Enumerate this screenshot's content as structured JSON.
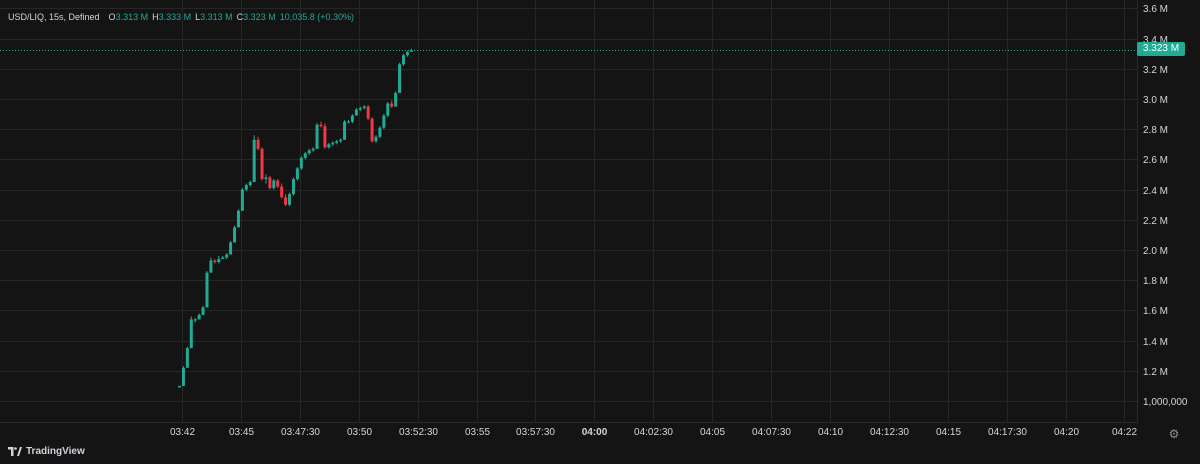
{
  "legend": {
    "symbol": "USD/LIQ, 15s, Defined",
    "open_label": "O",
    "open_value": "3.313 M",
    "high_label": "H",
    "high_value": "3.333 M",
    "low_label": "L",
    "low_value": "3.313 M",
    "close_label": "C",
    "close_value": "3.323 M",
    "change": "10,035.8 (+0.30%)"
  },
  "last_price_label": "3.323 M",
  "brand": {
    "name": "TradingView",
    "icon": "tradingview-logo-icon"
  },
  "colors": {
    "up": "#22ab94",
    "down": "#f23645",
    "grid": "#262626",
    "text": "#d1d4dc",
    "background": "#141414"
  },
  "chart_data": {
    "type": "candlestick",
    "title": "USD/LIQ, 15s, Defined",
    "interval_seconds": 15,
    "x_ticks": [
      "03:42",
      "03:45",
      "03:47:30",
      "03:50",
      "03:52:30",
      "03:55",
      "03:57:30",
      "04:00",
      "04:02:30",
      "04:05",
      "04:07:30",
      "04:10",
      "04:12:30",
      "04:15",
      "04:17:30",
      "04:20",
      "04:22"
    ],
    "y_ticks": [
      "1,000,000",
      "1.2 M",
      "1.4 M",
      "1.6 M",
      "1.8 M",
      "2.0 M",
      "2.2 M",
      "2.4 M",
      "2.6 M",
      "2.8 M",
      "3.0 M",
      "3.2 M",
      "3.4 M",
      "3.6 M"
    ],
    "y_range": [
      0.94,
      3.6
    ],
    "last_price": 3.323,
    "candles_ohlc_millions": [
      [
        1.09,
        1.1,
        1.09,
        1.1
      ],
      [
        1.1,
        1.23,
        1.1,
        1.22
      ],
      [
        1.22,
        1.36,
        1.22,
        1.35
      ],
      [
        1.35,
        1.56,
        1.35,
        1.54
      ],
      [
        1.54,
        1.55,
        1.52,
        1.54
      ],
      [
        1.54,
        1.58,
        1.54,
        1.57
      ],
      [
        1.57,
        1.63,
        1.57,
        1.62
      ],
      [
        1.62,
        1.86,
        1.62,
        1.85
      ],
      [
        1.85,
        1.95,
        1.85,
        1.93
      ],
      [
        1.93,
        1.94,
        1.91,
        1.92
      ],
      [
        1.92,
        1.96,
        1.91,
        1.94
      ],
      [
        1.94,
        1.96,
        1.94,
        1.95
      ],
      [
        1.95,
        1.98,
        1.94,
        1.97
      ],
      [
        1.97,
        2.06,
        1.97,
        2.05
      ],
      [
        2.05,
        2.16,
        2.05,
        2.15
      ],
      [
        2.15,
        2.27,
        2.15,
        2.26
      ],
      [
        2.26,
        2.41,
        2.26,
        2.4
      ],
      [
        2.4,
        2.44,
        2.39,
        2.43
      ],
      [
        2.43,
        2.46,
        2.42,
        2.45
      ],
      [
        2.45,
        2.76,
        2.45,
        2.73
      ],
      [
        2.73,
        2.75,
        2.66,
        2.67
      ],
      [
        2.67,
        2.68,
        2.46,
        2.47
      ],
      [
        2.47,
        2.5,
        2.44,
        2.48
      ],
      [
        2.48,
        2.49,
        2.4,
        2.41
      ],
      [
        2.41,
        2.47,
        2.4,
        2.46
      ],
      [
        2.46,
        2.47,
        2.41,
        2.42
      ],
      [
        2.42,
        2.44,
        2.34,
        2.35
      ],
      [
        2.35,
        2.37,
        2.29,
        2.3
      ],
      [
        2.3,
        2.38,
        2.29,
        2.37
      ],
      [
        2.37,
        2.48,
        2.36,
        2.47
      ],
      [
        2.47,
        2.55,
        2.46,
        2.54
      ],
      [
        2.54,
        2.62,
        2.53,
        2.61
      ],
      [
        2.61,
        2.65,
        2.6,
        2.64
      ],
      [
        2.64,
        2.67,
        2.63,
        2.66
      ],
      [
        2.66,
        2.68,
        2.65,
        2.67
      ],
      [
        2.67,
        2.84,
        2.67,
        2.83
      ],
      [
        2.83,
        2.85,
        2.81,
        2.82
      ],
      [
        2.82,
        2.84,
        2.67,
        2.68
      ],
      [
        2.68,
        2.71,
        2.67,
        2.7
      ],
      [
        2.7,
        2.72,
        2.69,
        2.71
      ],
      [
        2.71,
        2.73,
        2.7,
        2.72
      ],
      [
        2.72,
        2.74,
        2.71,
        2.73
      ],
      [
        2.73,
        2.86,
        2.73,
        2.85
      ],
      [
        2.85,
        2.86,
        2.84,
        2.85
      ],
      [
        2.85,
        2.9,
        2.84,
        2.89
      ],
      [
        2.89,
        2.94,
        2.89,
        2.93
      ],
      [
        2.93,
        2.95,
        2.92,
        2.94
      ],
      [
        2.94,
        2.96,
        2.93,
        2.95
      ],
      [
        2.95,
        2.96,
        2.86,
        2.87
      ],
      [
        2.87,
        2.88,
        2.71,
        2.72
      ],
      [
        2.72,
        2.76,
        2.71,
        2.75
      ],
      [
        2.75,
        2.82,
        2.74,
        2.81
      ],
      [
        2.81,
        2.9,
        2.8,
        2.89
      ],
      [
        2.89,
        2.98,
        2.88,
        2.97
      ],
      [
        2.97,
        2.99,
        2.94,
        2.95
      ],
      [
        2.95,
        3.05,
        2.95,
        3.04
      ],
      [
        3.04,
        3.24,
        3.04,
        3.23
      ],
      [
        3.23,
        3.3,
        3.22,
        3.29
      ],
      [
        3.29,
        3.32,
        3.28,
        3.31
      ],
      [
        3.313,
        3.333,
        3.313,
        3.323
      ]
    ]
  }
}
